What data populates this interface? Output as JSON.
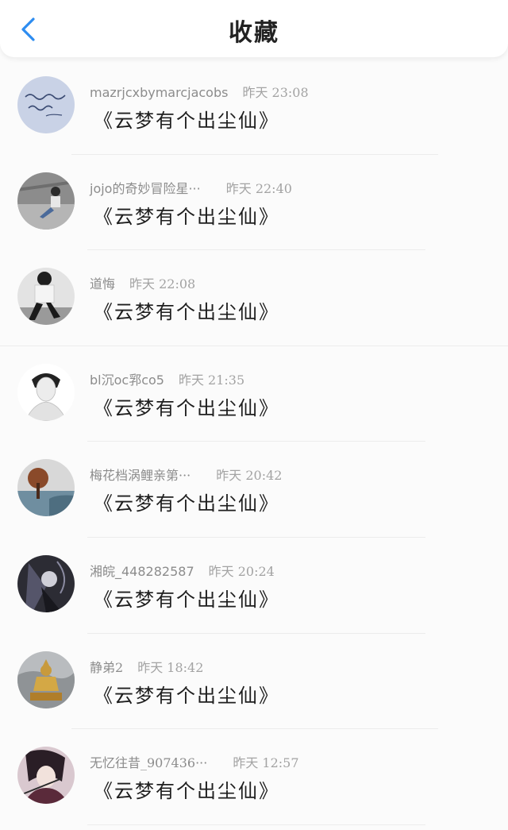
{
  "header": {
    "title": "收藏",
    "back_icon": "chevron-left-icon",
    "accent_color": "#2d8cf0"
  },
  "items": [
    {
      "name": "mazrjcxbymarcjacobs",
      "time": "昨天 23:08",
      "content": "《云梦有个出尘仙》",
      "avatar": "handwriting-avatar"
    },
    {
      "name": "jojo的奇妙冒险星···",
      "time": "昨天 22:40",
      "content": "《云梦有个出尘仙》",
      "avatar": "person-sitting-avatar"
    },
    {
      "name": "道悔",
      "time": "昨天 22:08",
      "content": "《云梦有个出尘仙》",
      "avatar": "person-walking-avatar"
    },
    {
      "name": "bl沉oc郛co5",
      "time": "昨天 21:35",
      "content": "《云梦有个出尘仙》",
      "avatar": "portrait-avatar"
    },
    {
      "name": "梅花档涡鲤亲第···",
      "time": "昨天 20:42",
      "content": "《云梦有个出尘仙》",
      "avatar": "tree-landscape-avatar"
    },
    {
      "name": "湘皖_448282587",
      "time": "昨天 20:24",
      "content": "《云梦有个出尘仙》",
      "avatar": "dark-illustration-avatar"
    },
    {
      "name": "静弟2",
      "time": "昨天 18:42",
      "content": "《云梦有个出尘仙》",
      "avatar": "statue-avatar"
    },
    {
      "name": "无忆往昔_907436···",
      "time": "昨天 12:57",
      "content": "《云梦有个出尘仙》",
      "avatar": "anime-character-avatar"
    }
  ]
}
